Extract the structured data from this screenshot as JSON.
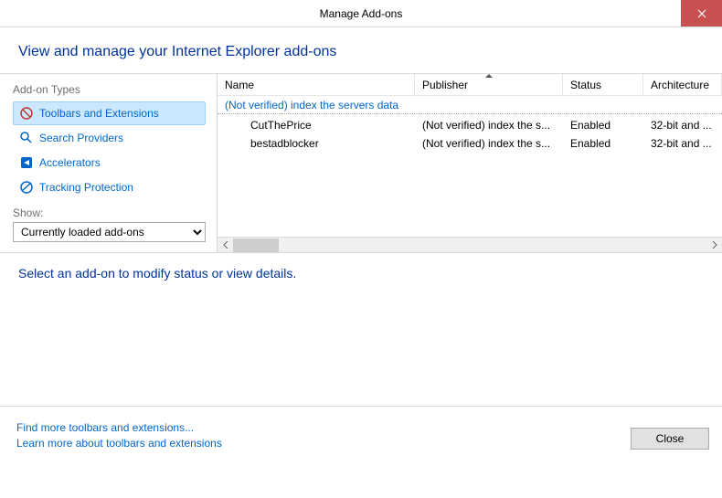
{
  "titlebar": {
    "title": "Manage Add-ons"
  },
  "header": {
    "title": "View and manage your Internet Explorer add-ons"
  },
  "sidebar": {
    "types_label": "Add-on Types",
    "items": [
      {
        "label": "Toolbars and Extensions"
      },
      {
        "label": "Search Providers"
      },
      {
        "label": "Accelerators"
      },
      {
        "label": "Tracking Protection"
      }
    ],
    "show_label": "Show:",
    "show_value": "Currently loaded add-ons"
  },
  "table": {
    "headers": {
      "name": "Name",
      "publisher": "Publisher",
      "status": "Status",
      "architecture": "Architecture"
    },
    "group": "(Not verified) index the servers data",
    "rows": [
      {
        "name": "CutThePrice",
        "publisher": "(Not verified) index the s...",
        "status": "Enabled",
        "arch": "32-bit and ..."
      },
      {
        "name": "bestadblocker",
        "publisher": "(Not verified) index the s...",
        "status": "Enabled",
        "arch": "32-bit and ..."
      }
    ]
  },
  "details": {
    "text": "Select an add-on to modify status or view details."
  },
  "footer": {
    "link1": "Find more toolbars and extensions...",
    "link2": "Learn more about toolbars and extensions",
    "close": "Close"
  }
}
